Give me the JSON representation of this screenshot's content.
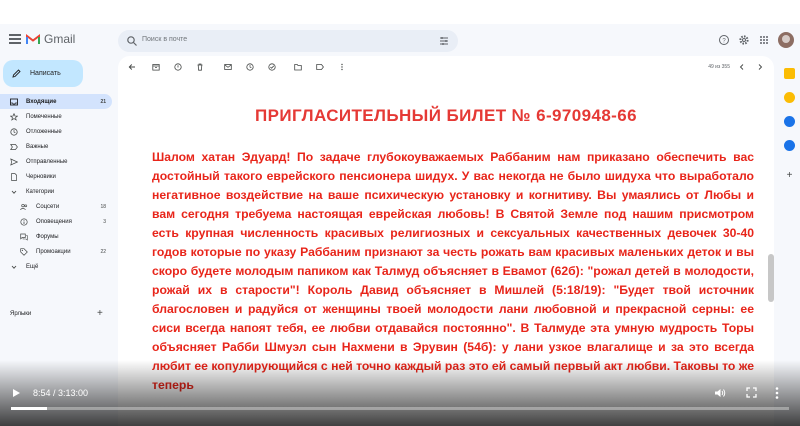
{
  "app": {
    "name": "Gmail"
  },
  "search": {
    "placeholder": "Поиск в почте"
  },
  "compose": {
    "label": "Написать"
  },
  "sidebar": {
    "items": [
      {
        "label": "Входящие",
        "count": "21",
        "icon": "inbox-icon",
        "active": true
      },
      {
        "label": "Помеченные",
        "count": "",
        "icon": "star-icon"
      },
      {
        "label": "Отложенные",
        "count": "",
        "icon": "clock-icon"
      },
      {
        "label": "Важные",
        "count": "",
        "icon": "label-important-icon"
      },
      {
        "label": "Отправленные",
        "count": "",
        "icon": "send-icon"
      },
      {
        "label": "Черновики",
        "count": "",
        "icon": "draft-icon"
      },
      {
        "label": "Категории",
        "count": "",
        "icon": "chevron-down-icon"
      },
      {
        "label": "Соцсети",
        "count": "18",
        "icon": "people-icon"
      },
      {
        "label": "Оповещения",
        "count": "3",
        "icon": "info-icon"
      },
      {
        "label": "Форумы",
        "count": "",
        "icon": "forum-icon"
      },
      {
        "label": "Промоакции",
        "count": "22",
        "icon": "tag-icon"
      },
      {
        "label": "Ещё",
        "count": "",
        "icon": "chevron-down-icon"
      }
    ],
    "labels_header": "Ярлыки"
  },
  "toolbar": {
    "pager": "49 из 355"
  },
  "message": {
    "title": "ПРИГЛАСИТЕЛЬНЫЙ БИЛЕТ № 6-970948-66",
    "body": "Шалом хатан Эдуард! По задаче глубокоуважаемых Раббаним нам приказано обеспечить вас достойный такого еврейского пенсионера шидух. У вас некогда не было шидуха что выработало негативное воздействие на ваше психическую установку и когнитиву. Вы умаялись от Любы и вам сегодня требуема настоящая еврейская любовь! В Святой Земле под нашим присмотром есть крупная численность красивых религиозных и сексуальных качественных девочек 30-40 годов которые по указу Раббаним признают за честь рожать вам красивых маленьких деток и вы скоро будете молодым папиком как Талмуд объясняет в Евамот (62б): \"рожал детей в молодости, рожай их в старости\"! Король Давид объясняет в Мишлей (5:18/19): \"Будет твой источник благословен и радуйся от женщины твоей молодости лани любовной и прекрасной серны: ее сиси всегда напоят тебя, ее любви отдавайся постоянно\". В Талмуде эта умную мудрость Торы объясняет Рабби Шмуэл сын Нахмени в Эрувин (54б): у лани узкое влагалище и за это всегда любит ее копулирующийся с ней точно каждый раз это ей самый первый акт любви. Таковы то же теперь"
  },
  "video": {
    "time": "8:54 / 3:13:00",
    "progress": 0.046
  },
  "colors": {
    "accent": "#c2e7ff",
    "active_nav": "#d3e3fd",
    "message_text": "#e8251a",
    "gmail_bg": "#f6f8fc"
  }
}
